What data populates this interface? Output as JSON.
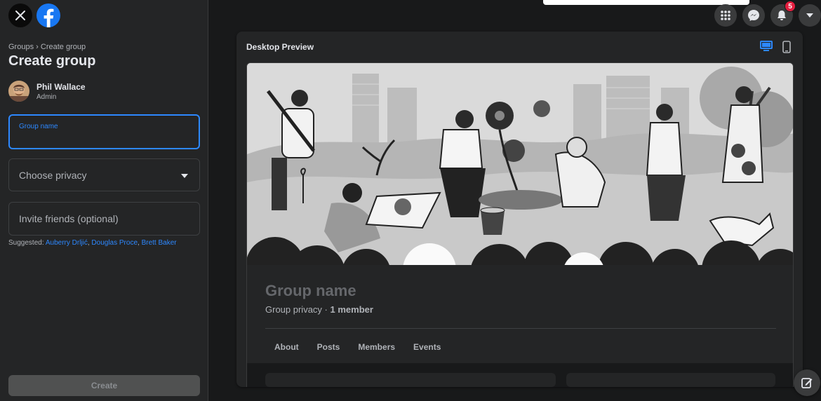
{
  "sidebar": {
    "breadcrumb": {
      "groups": "Groups",
      "separator": "›",
      "current": "Create group"
    },
    "title": "Create group",
    "user": {
      "name": "Phil Wallace",
      "role": "Admin"
    },
    "group_name_field": {
      "label": "Group name",
      "value": ""
    },
    "privacy_field": {
      "placeholder": "Choose privacy"
    },
    "invite_field": {
      "placeholder": "Invite friends (optional)"
    },
    "suggested": {
      "label": "Suggested:",
      "names": [
        "Auberry Drljić",
        "Douglas Proce",
        "Brett Baker"
      ]
    },
    "create_button": "Create"
  },
  "topbar": {
    "notifications_badge": "5"
  },
  "preview": {
    "title": "Desktop Preview",
    "group_name": "Group name",
    "privacy_text": "Group privacy",
    "separator": "·",
    "members_text": "1 member",
    "tabs": [
      "About",
      "Posts",
      "Members",
      "Events"
    ]
  },
  "colors": {
    "accent": "#2d88ff",
    "badge": "#e41e3f",
    "background": "#18191a",
    "panel": "#242526"
  }
}
